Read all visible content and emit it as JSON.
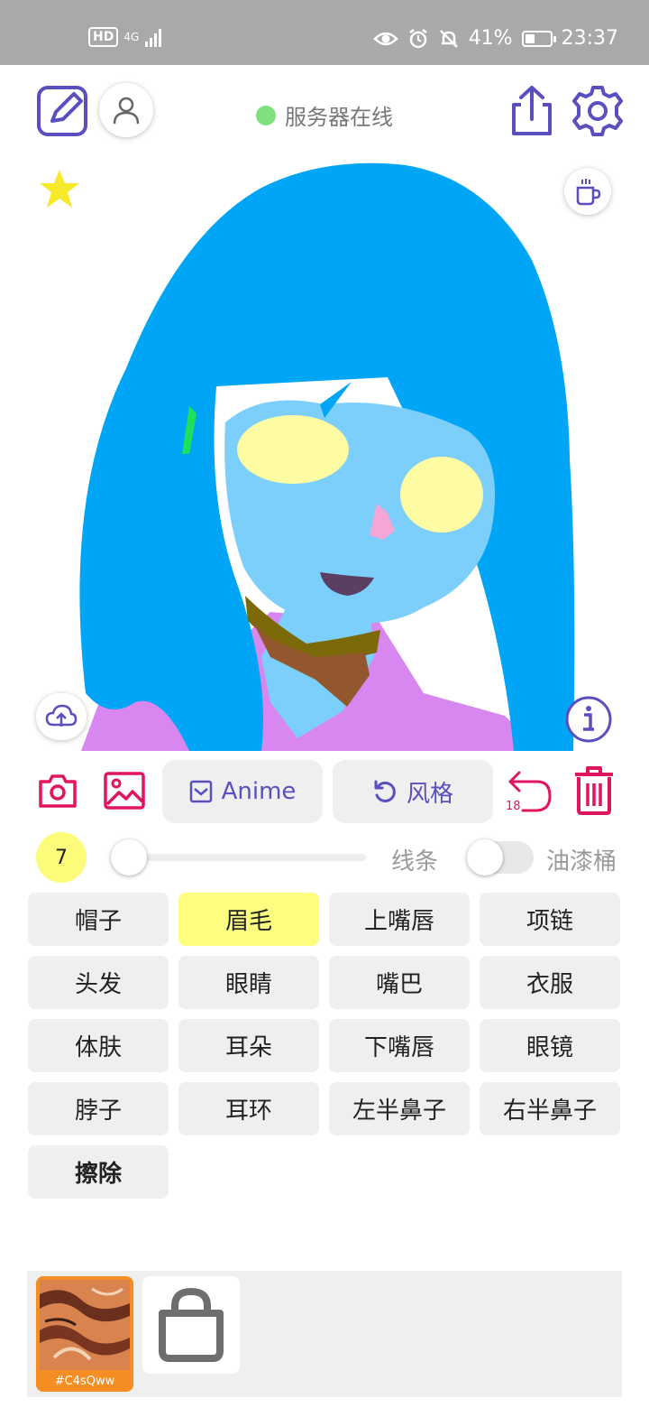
{
  "status_bar": {
    "hd": "HD",
    "network": "4G",
    "battery": "41%",
    "battery_level": 0.41,
    "time": "23:37"
  },
  "toolbar": {
    "server_status": "服务器在线",
    "server_status_color": "#7ee07e"
  },
  "tools": {
    "anime_label": "Anime",
    "style_label": "风格",
    "undo_count": "18",
    "brush_size": "7",
    "line_label": "线条",
    "bucket_label": "油漆桶"
  },
  "parts": [
    {
      "label": "帽子",
      "selected": false
    },
    {
      "label": "眉毛",
      "selected": true
    },
    {
      "label": "上嘴唇",
      "selected": false
    },
    {
      "label": "项链",
      "selected": false
    },
    {
      "label": "头发",
      "selected": false
    },
    {
      "label": "眼睛",
      "selected": false
    },
    {
      "label": "嘴巴",
      "selected": false
    },
    {
      "label": "衣服",
      "selected": false
    },
    {
      "label": "体肤",
      "selected": false
    },
    {
      "label": "耳朵",
      "selected": false
    },
    {
      "label": "下嘴唇",
      "selected": false
    },
    {
      "label": "眼镜",
      "selected": false
    },
    {
      "label": "脖子",
      "selected": false
    },
    {
      "label": "耳环",
      "selected": false
    },
    {
      "label": "左半鼻子",
      "selected": false
    },
    {
      "label": "右半鼻子",
      "selected": false
    },
    {
      "label": "擦除",
      "selected": false
    }
  ],
  "tray": {
    "texture_code": "#C4sQww"
  },
  "colors": {
    "accent": "#5a4fbf",
    "danger": "#e01560",
    "selected": "#fdfd80",
    "brush_size_bg": "#fcfc7a",
    "hair": "#00a6f5",
    "skin": "#7dcffb",
    "eyes": "#fdfca3",
    "cheek": "#f5a6d6",
    "mouth": "#5a3f63",
    "collar": "#7c6a09",
    "scarf": "#93572f",
    "clothes": "#d887f1",
    "hair_accent": "#1fe05a"
  }
}
